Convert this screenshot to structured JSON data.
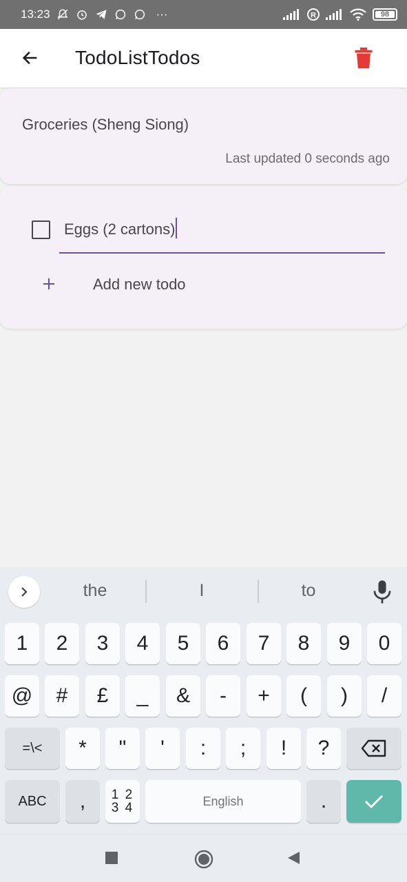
{
  "status_bar": {
    "time": "13:23",
    "more": "···",
    "battery": "98",
    "left_icons": [
      "mute-icon",
      "alarm-icon",
      "telegram-icon",
      "whatsapp-icon",
      "whatsapp-icon"
    ],
    "right_icons": [
      "signal-icon",
      "roaming-icon",
      "signal-icon",
      "wifi-icon",
      "battery-icon"
    ]
  },
  "app_bar": {
    "title": "TodoListTodos",
    "back_icon": "arrow-left-icon",
    "delete_icon": "trash-icon",
    "delete_color": "#e53935"
  },
  "list_card": {
    "name": "Groceries (Sheng Siong)",
    "last_updated": "Last updated 0 seconds ago"
  },
  "todos": {
    "items": [
      {
        "text": "Eggs (2 cartons)",
        "checked": false,
        "editing": true
      }
    ],
    "add_label": "Add new todo",
    "accent": "#6750a4"
  },
  "keyboard": {
    "suggestions": [
      "the",
      "I",
      "to"
    ],
    "row1": [
      "1",
      "2",
      "3",
      "4",
      "5",
      "6",
      "7",
      "8",
      "9",
      "0"
    ],
    "row2": [
      "@",
      "#",
      "£",
      "_",
      "&",
      "-",
      "+",
      "(",
      ")",
      "/"
    ],
    "row3": [
      "=\\<",
      "*",
      "\"",
      "'",
      ":",
      ";",
      "!",
      "?"
    ],
    "row4": {
      "abc": "ABC",
      "comma": ",",
      "numpad_top": "1 2",
      "numpad_bottom": "3 4",
      "space": "English",
      "period": "."
    },
    "enter_color": "#5fb8aa"
  },
  "nav_bar": {
    "icons": [
      "recent-apps-icon",
      "home-icon",
      "back-icon"
    ]
  }
}
